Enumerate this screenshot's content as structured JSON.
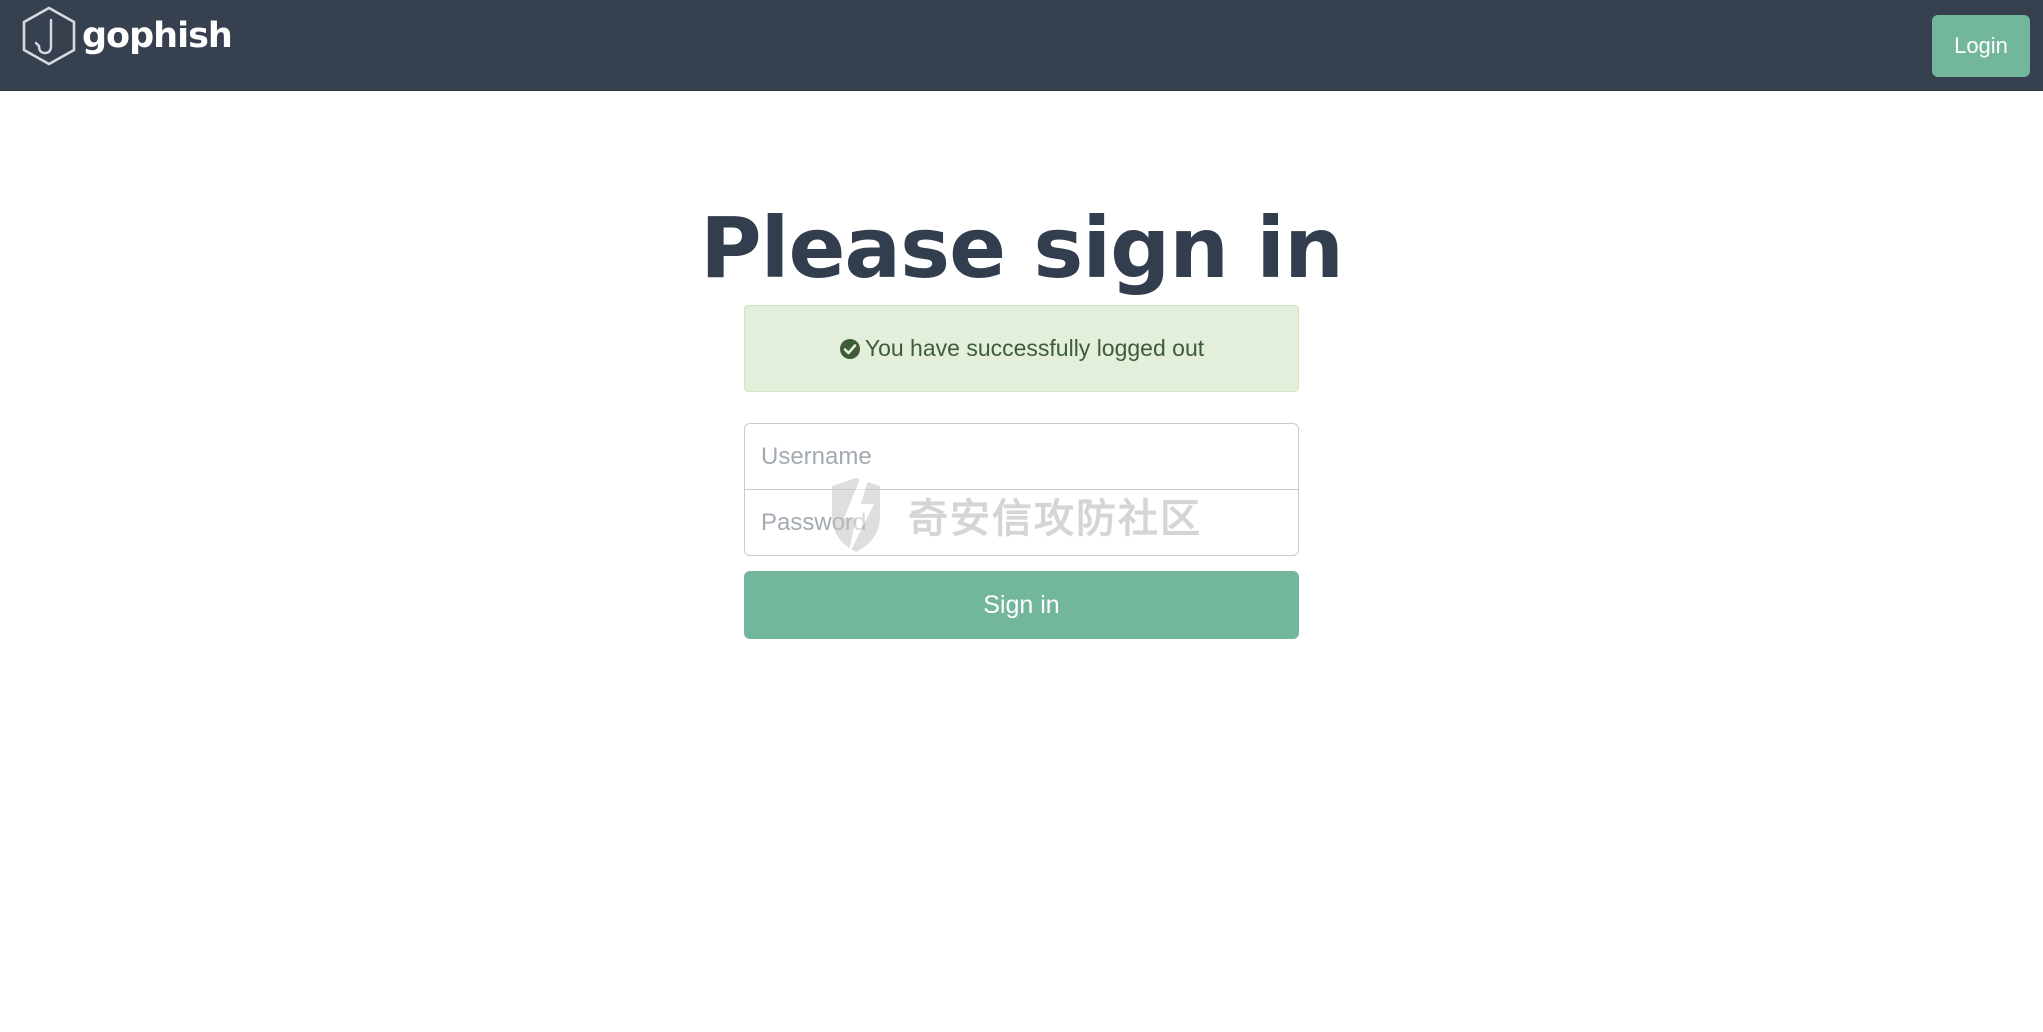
{
  "navbar": {
    "brand_name": "gophish",
    "login_label": "Login",
    "background": "#37404f"
  },
  "page": {
    "heading": "Please sign in"
  },
  "alert": {
    "icon": "check-circle-icon",
    "message": "You have successfully logged out",
    "background": "#e4efdb"
  },
  "form": {
    "username_placeholder": "Username",
    "password_placeholder": "Password",
    "submit_label": "Sign in",
    "accent": "#72b69c"
  },
  "watermark": {
    "text": "奇安信攻防社区"
  }
}
